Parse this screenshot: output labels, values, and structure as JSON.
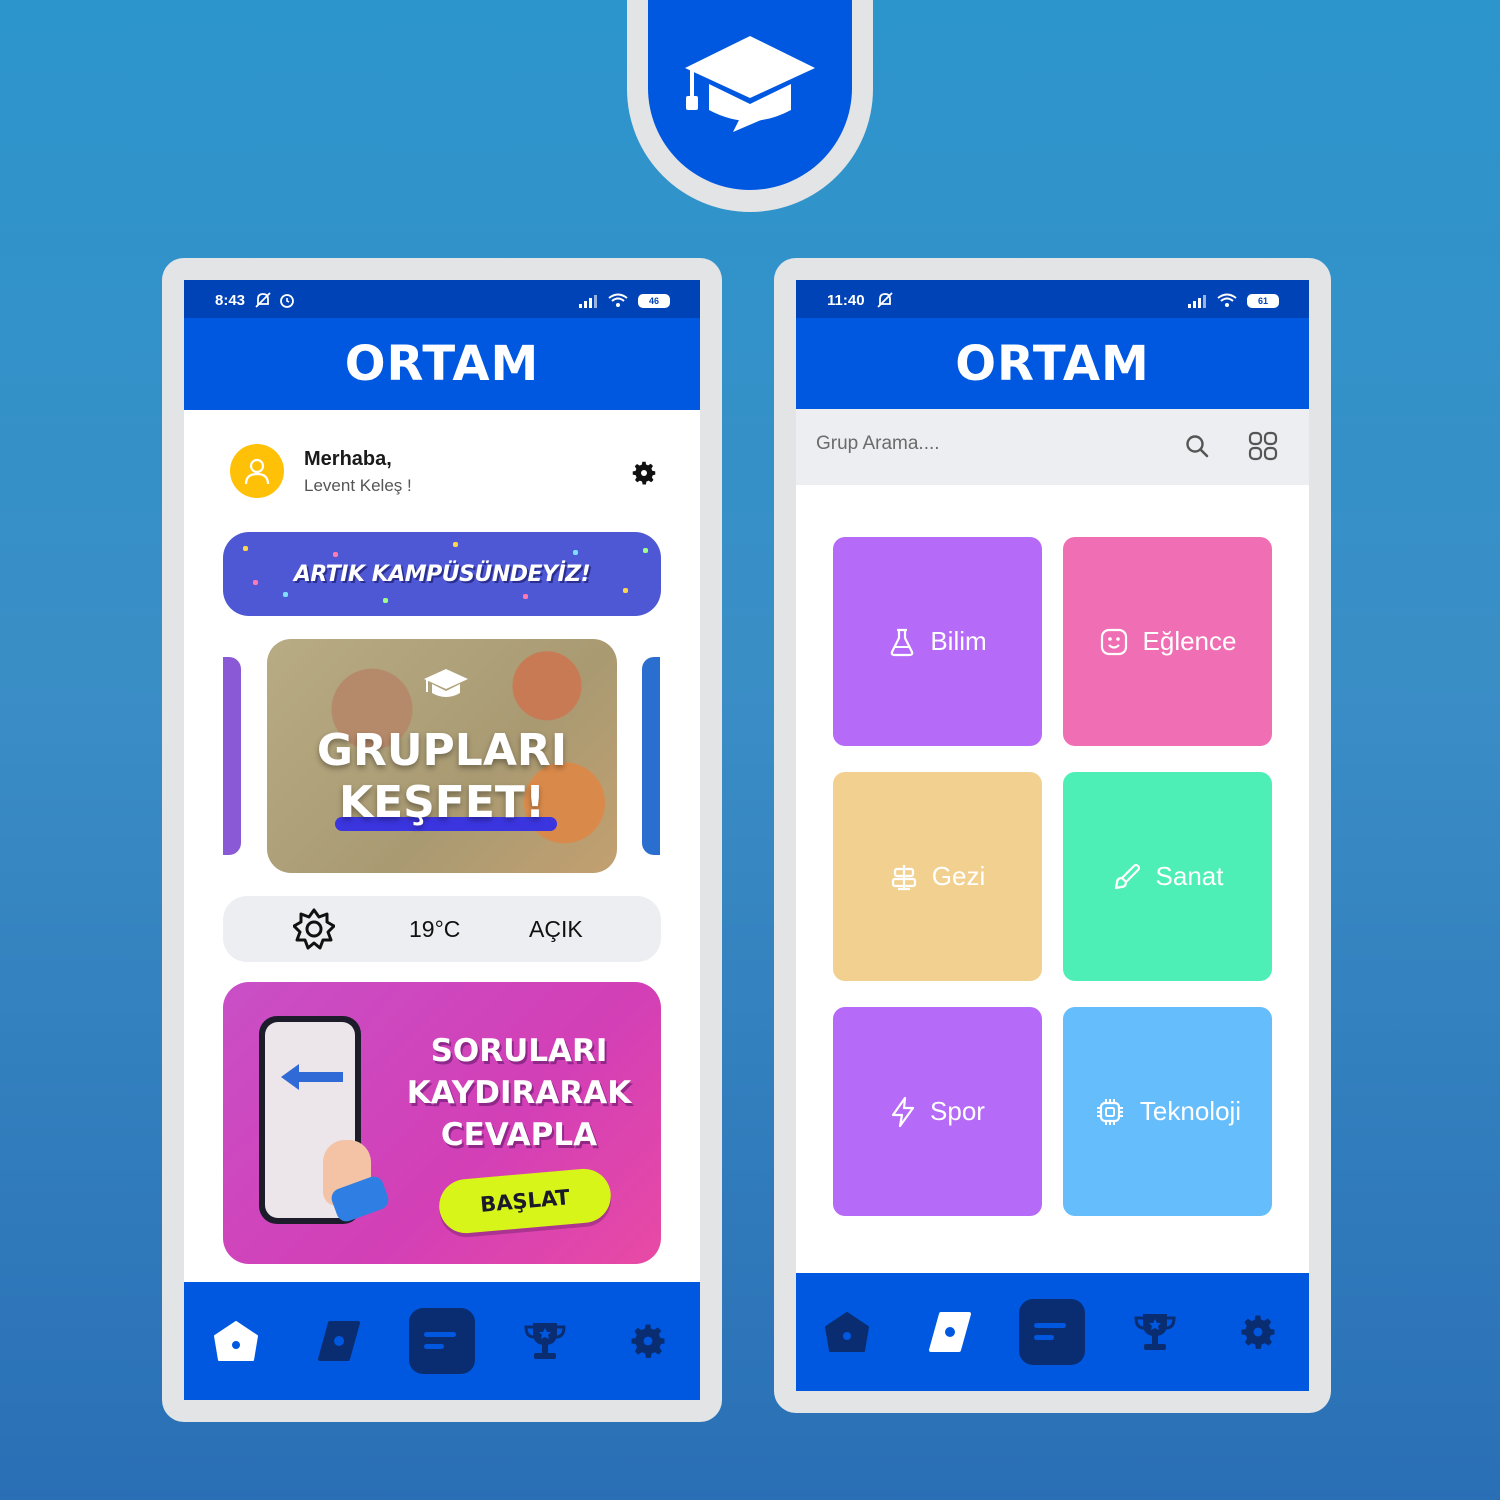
{
  "logo": {
    "icon": "graduation-cap-icon",
    "color": "#0058e1"
  },
  "left_phone": {
    "status": {
      "time": "8:43",
      "battery": "46"
    },
    "header": {
      "title": "ORTAM"
    },
    "greeting": {
      "title": "Merhaba,",
      "name": "Levent Keleş !"
    },
    "banner": {
      "text": "ARTIK KAMPÜSÜNDEYİZ!"
    },
    "carousel": {
      "line1": "GRUPLARI",
      "line2": "KEŞFET!"
    },
    "weather": {
      "temp": "19°C",
      "condition": "AÇIK"
    },
    "promo": {
      "line1": "SORULARI",
      "line2": "KAYDIRARAK",
      "line3": "CEVAPLA",
      "button": "BAŞLAT"
    },
    "nav": [
      "home-icon",
      "discover-icon",
      "chat-icon",
      "trophy-icon",
      "settings-icon"
    ]
  },
  "right_phone": {
    "status": {
      "time": "11:40",
      "battery": "61"
    },
    "header": {
      "title": "ORTAM"
    },
    "search": {
      "placeholder": "Grup Arama...."
    },
    "categories": [
      {
        "label": "Bilim",
        "icon": "flask-icon",
        "color": "#b56bf7"
      },
      {
        "label": "Eğlence",
        "icon": "smile-icon",
        "color": "#f06eb3"
      },
      {
        "label": "Gezi",
        "icon": "luggage-icon",
        "color": "#f2d190"
      },
      {
        "label": "Sanat",
        "icon": "brush-icon",
        "color": "#4eefb6"
      },
      {
        "label": "Spor",
        "icon": "lightning-icon",
        "color": "#b56bf7"
      },
      {
        "label": "Teknoloji",
        "icon": "chip-icon",
        "color": "#66bdfc"
      }
    ],
    "nav": [
      "home-icon",
      "discover-icon",
      "chat-icon",
      "trophy-icon",
      "settings-icon"
    ]
  }
}
